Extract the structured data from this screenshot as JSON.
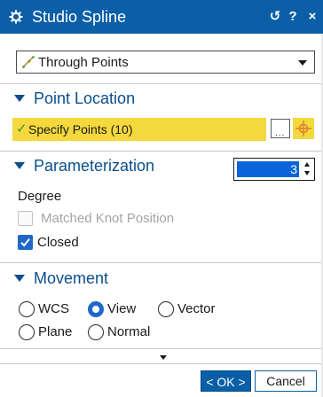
{
  "window": {
    "title": "Studio Spline",
    "reset_glyph": "↺",
    "help_glyph": "?",
    "close_glyph": "×",
    "icon": "gear-icon"
  },
  "type_dropdown": {
    "value": "Through Points",
    "icon": "spline-icon"
  },
  "point_location": {
    "header": "Point Location",
    "specify_label": "Specify Points (10)",
    "check_glyph": "✓",
    "dialog_button_glyph": "...",
    "point_button_icon": "point-crosshair-icon"
  },
  "parameterization": {
    "header": "Parameterization",
    "degree_label": "Degree",
    "degree_value": "3",
    "matched_knot_label": "Matched Knot Position",
    "matched_knot_checked": false,
    "closed_label": "Closed",
    "closed_checked": true
  },
  "movement": {
    "header": "Movement",
    "options": [
      "WCS",
      "View",
      "Vector",
      "Plane",
      "Normal"
    ],
    "selected": "View"
  },
  "footer": {
    "ok_label": "< OK >",
    "cancel_label": "Cancel"
  },
  "colors": {
    "titlebar": "#0a5fa6",
    "section_header": "#0a4f8c",
    "highlight": "#f4d83d",
    "accent": "#1f67c8"
  }
}
